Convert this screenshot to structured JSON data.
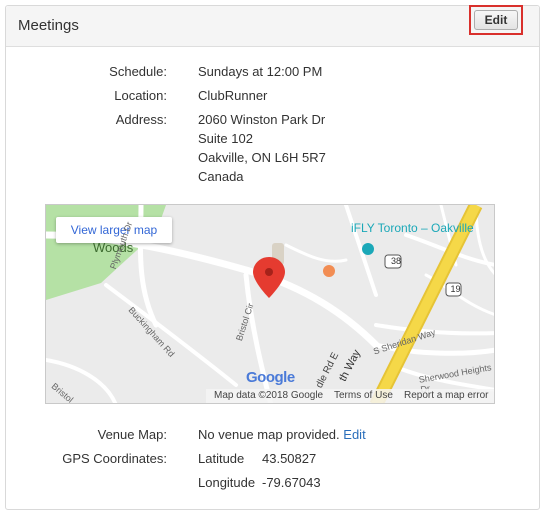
{
  "panel": {
    "title": "Meetings",
    "edit_label": "Edit"
  },
  "details": {
    "schedule_label": "Schedule:",
    "schedule_value": "Sundays at 12:00 PM",
    "location_label": "Location:",
    "location_value": "ClubRunner",
    "address_label": "Address:",
    "address_lines": [
      "2060 Winston Park Dr",
      "Suite 102",
      "Oakville, ON  L6H 5R7",
      "Canada"
    ],
    "venue_map_label": "Venue Map:",
    "venue_map_text": "No venue map provided.",
    "venue_map_edit": "Edit",
    "gps_label": "GPS Coordinates:",
    "latitude_label": "Latitude",
    "latitude_value": "43.50827",
    "longitude_label": "Longitude",
    "longitude_value": "-79.67043"
  },
  "map": {
    "view_larger": "View larger map",
    "place_woods": "Woods",
    "place_ifly": "iFLY Toronto – Oakville",
    "road_plymouth": "Plymouth Dr",
    "road_buckingham": "Buckingham Rd",
    "road_bristol_cir": "Bristol Cir",
    "road_bristol": "Bristol",
    "road_sheridan": "S Sheridan Way",
    "road_sherwood": "Sherwood Heights Dr",
    "road_trafalgar": "th Way",
    "road_ddle": "dle Rd E",
    "shield_38": "38",
    "shield_19": "19",
    "google_logo": "Google",
    "map_data": "Map data ©2018 Google",
    "terms": "Terms of Use",
    "report": "Report a map error",
    "colors": {
      "highway": "#f5d848",
      "park": "#b5e1a5",
      "marker": "#e53b30",
      "poi": "#f28d53",
      "poi_blue": "#1ba8b8"
    }
  }
}
